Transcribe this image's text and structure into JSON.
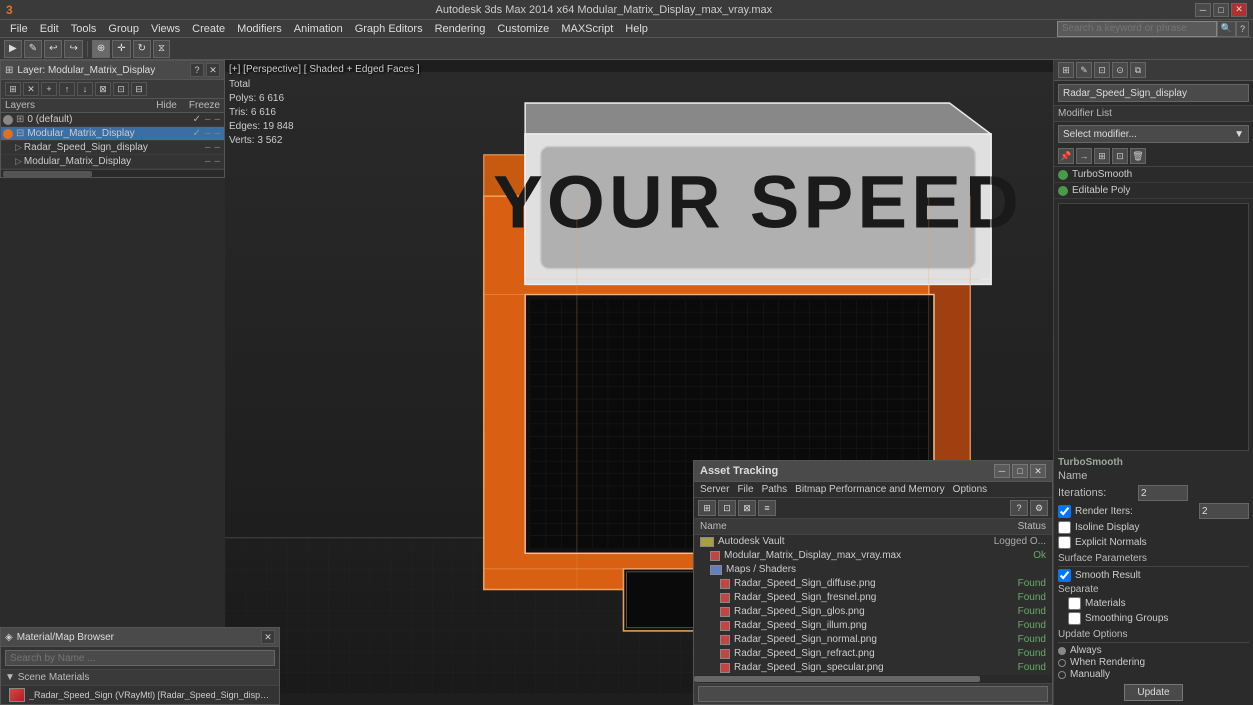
{
  "window": {
    "title": "Autodesk 3ds Max 2014 x64    Modular_Matrix_Display_max_vray.max",
    "search_placeholder": "Search a keyword or phrase"
  },
  "menubar": {
    "items": [
      "File",
      "Edit",
      "Tools",
      "Group",
      "Views",
      "Create",
      "Modifiers",
      "Animation",
      "Graph Editors",
      "Rendering",
      "Customize",
      "MAXScript",
      "Help"
    ]
  },
  "toolbar": {
    "undo_icon": "↩",
    "redo_icon": "↪"
  },
  "viewport": {
    "label": "[+] [Perspective] [ Shaded + Edged Faces ]",
    "stats": {
      "total_label": "Total",
      "polys_label": "Polys:",
      "polys_val": "6 616",
      "tris_label": "Tris:",
      "tris_val": "6 616",
      "edges_label": "Edges:",
      "edges_val": "19 848",
      "verts_label": "Verts:",
      "verts_val": "3 562"
    }
  },
  "layers_panel": {
    "title": "Layer: Modular_Matrix_Display",
    "layers_label": "Layers",
    "hide_label": "Hide",
    "freeze_label": "Freeze",
    "items": [
      {
        "name": "0 (default)",
        "indent": 0,
        "type": "default"
      },
      {
        "name": "Modular_Matrix_Display",
        "indent": 1,
        "type": "colored",
        "selected": true
      },
      {
        "name": "Radar_Speed_Sign_display",
        "indent": 2,
        "type": "child"
      },
      {
        "name": "Modular_Matrix_Display",
        "indent": 2,
        "type": "child"
      }
    ]
  },
  "material_panel": {
    "title": "Material/Map Browser",
    "search_placeholder": "Search by Name ...",
    "section": "Scene Materials",
    "material_name": "_Radar_Speed_Sign  (VRayMtl) [Radar_Speed_Sign_display]"
  },
  "right_panel": {
    "object_name": "Radar_Speed_Sign_display",
    "modifier_list_label": "Modifier List",
    "modifiers": [
      {
        "name": "TurboSmooth",
        "active": true
      },
      {
        "name": "Editable Poly",
        "active": true
      }
    ],
    "turbosmoother": {
      "name_label": "Name",
      "name_val": "TurboSmooth",
      "iterations_label": "Iterations:",
      "iterations_val": "2",
      "render_iters_label": "Render Iters:",
      "render_iters_val": "2",
      "isoline_label": "Isoline Display",
      "explicit_normals_label": "Explicit Normals",
      "surface_params_label": "Surface Parameters",
      "smooth_result_label": "Smooth Result",
      "separate_label": "Separate",
      "materials_label": "Materials",
      "smoothing_groups_label": "Smoothing Groups",
      "update_options_label": "Update Options",
      "always_label": "Always",
      "when_rendering_label": "When Rendering",
      "manually_label": "Manually",
      "update_btn": "Update"
    }
  },
  "asset_panel": {
    "title": "Asset Tracking",
    "menu_items": [
      "Server",
      "File",
      "Paths",
      "Bitmap Performance and Memory",
      "Options"
    ],
    "col_name": "Name",
    "col_status": "Status",
    "rows": [
      {
        "name": "Autodesk Vault",
        "status": "Logged O...",
        "indent": 0,
        "type": "vault"
      },
      {
        "name": "Modular_Matrix_Display_max_vray.max",
        "status": "Ok",
        "indent": 1,
        "type": "file"
      },
      {
        "name": "Maps / Shaders",
        "status": "",
        "indent": 1,
        "type": "folder"
      },
      {
        "name": "Radar_Speed_Sign_diffuse.png",
        "status": "Found",
        "indent": 2,
        "type": "file"
      },
      {
        "name": "Radar_Speed_Sign_fresnel.png",
        "status": "Found",
        "indent": 2,
        "type": "file"
      },
      {
        "name": "Radar_Speed_Sign_glos.png",
        "status": "Found",
        "indent": 2,
        "type": "file"
      },
      {
        "name": "Radar_Speed_Sign_illum.png",
        "status": "Found",
        "indent": 2,
        "type": "file"
      },
      {
        "name": "Radar_Speed_Sign_normal.png",
        "status": "Found",
        "indent": 2,
        "type": "file"
      },
      {
        "name": "Radar_Speed_Sign_refract.png",
        "status": "Found",
        "indent": 2,
        "type": "file"
      },
      {
        "name": "Radar_Speed_Sign_specular.png",
        "status": "Found",
        "indent": 2,
        "type": "file"
      }
    ]
  }
}
